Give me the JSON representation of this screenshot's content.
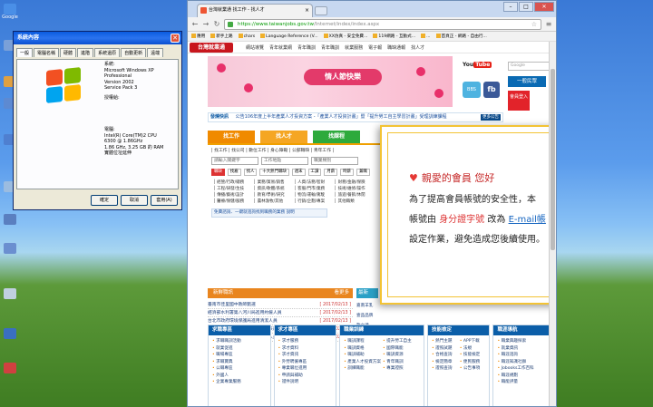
{
  "desktop": {
    "icons": [
      {
        "label": "Google",
        "color": "#4a8fe7"
      },
      {
        "label": "",
        "color": "#7aa0d8"
      },
      {
        "label": "",
        "color": "#e0a040"
      },
      {
        "label": "",
        "color": "#5d8ad2"
      },
      {
        "label": "",
        "color": "#4f7fd0"
      },
      {
        "label": "",
        "color": "#9bbce0"
      },
      {
        "label": "",
        "color": "#5a7fc0"
      },
      {
        "label": "",
        "color": "#6b8fd0"
      },
      {
        "label": "",
        "color": "#c0d0e0"
      },
      {
        "label": "",
        "color": "#3a6fc0"
      },
      {
        "label": "",
        "color": "#d04040"
      }
    ]
  },
  "system_properties": {
    "title": "系統內容",
    "tabs": [
      "一般",
      "電腦名稱",
      "硬體",
      "進階",
      "系統還原",
      "自動更新",
      "遠端"
    ],
    "system_label": "系統:",
    "os_name": "Microsoft Windows XP",
    "edition": "Professional",
    "version": "Version 2002",
    "service_pack": "Service Pack 3",
    "registered_label": "授權給:",
    "computer_label": "電腦:",
    "cpu1": "Intel(R) Core(TM)2 CPU",
    "cpu2": "6300 @ 1.86GHz",
    "memory": "1.86 GHz, 3.25 GB 的 RAM",
    "pae": "實體位址延伸",
    "ok_button": "確定",
    "cancel_button": "取消",
    "apply_button": "套用(A)"
  },
  "browser": {
    "tab_title": "台灣就業通 找工作 - 找人才",
    "url_host": "https://www.taiwanjobs.gov.tw",
    "url_path": "/Internet/index/index.aspx",
    "bookmarks": [
      "應用",
      "新手上路",
      "chars",
      "Language Reference (V...",
      "XX仿真 - 安全免費...",
      "119網路 - 互動式...",
      "...",
      "首頁正 - 網路 - 自由行..."
    ],
    "window_controls": [
      "–",
      "□",
      "✕"
    ]
  },
  "site": {
    "logo": "台灣就業通",
    "topnav": [
      "網站導覽",
      "青年就業網",
      "青年職訓",
      "青年職訓",
      "就業服務",
      "電子報",
      "職缺通報",
      "找人才"
    ],
    "hero_text": "情人節快樂",
    "youtube": "You",
    "youtube_tube": "Tube",
    "bbs": "BBS",
    "fb": "fb",
    "search_placeholder": "Google",
    "general_user": "一般民眾",
    "member_login": "會員登入",
    "news_label": "發燒快訊",
    "news_text": "公告106年度上半年產業人才投資方案 -「產業人才投資計畫」暨「提升勞工自主學習計畫」受理訓練課程",
    "news_more": "更多公告",
    "job_tabs": [
      {
        "label": "找工作",
        "color": "#f08a00"
      },
      {
        "label": "找人才",
        "color": "#f5a623"
      },
      {
        "label": "找課程",
        "color": "#2eaa3c"
      }
    ],
    "panel_links": "| 找工作 | 找公司 | 數位工作 | 身心障礙 | 公部職缺 | 青年工作 |",
    "keyword_placeholder": "請輸入關鍵字",
    "select_area": "工作地點",
    "select_category": "職業類別",
    "chips": [
      "職缺",
      "找雇",
      "找人",
      "十大熱門職缺",
      "週末",
      "工讀",
      "月薪",
      "時薪",
      "兼職"
    ],
    "categories": [
      "經營/行政/總務",
      "業務/貿易/銷售",
      "人資/法務/智財",
      "財務/金融/保險",
      "工程/研發/生技",
      "資訊/軟體/系統",
      "客服/門市/業務",
      "技術/維修/操作",
      "傳播/藝術/設計",
      "教育/學術/研究",
      "物流/運輸/駕駛",
      "旅遊/餐飲/休閒",
      "醫療/保健/服務",
      "農林漁牧/其他",
      "行銷/企劃/專案",
      "其他職類"
    ],
    "note_text": "免費諮詢、一鍵就諮詢找到職務的業務",
    "note_link": "說明",
    "latest_title": "新鮮職訊",
    "latest_more": "看更多",
    "latest": [
      {
        "title": "臺南市佳里國中教師甄選",
        "date": "[ 2017/02/13 ]"
      },
      {
        "title": "經濟部水利署第八河川局進用約僱人員",
        "date": "[ 2017/02/13 ]"
      },
      {
        "title": "台北市政府環境保護局進用清潔人員",
        "date": "[ 2017/02/13 ]"
      },
      {
        "title": "臺北市政府捷運工程局2/14-2/16進行甄試",
        "date": "[ 2017/02/13 ]"
      },
      {
        "title": "桃園市政府衛生局進用職務代理人員",
        "date": "[ 2017/02/13 ]"
      }
    ],
    "side_title": "最新",
    "side_items": [
      "嘉南羊乳",
      "壹品品牌",
      "歐立達",
      "多到府",
      "2/14-2/"
    ],
    "bottom_cols": [
      {
        "title": "求職專區",
        "items": [
          "求職職訓活動",
          "就業促進",
          "職場專區",
          "求職寶典",
          "公職專區",
          "外國人",
          "企業專業服務"
        ],
        "cls": "one"
      },
      {
        "title": "求才專區",
        "items": [
          "求才服務",
          "求才資料",
          "求才資訊",
          "外勞聘僱專區",
          "專業職位進用",
          "申請與補助",
          "證件說明"
        ],
        "cls": "one"
      },
      {
        "title": "職業訓練",
        "items": [
          "職訓課程",
          "職訓資格",
          "職訓補助",
          "產業人才投資方案",
          "訓練職能",
          "提升勞工自主",
          "國際職能",
          "職訓資源",
          "青年職訓",
          "專業證照"
        ],
        "cls": ""
      },
      {
        "title": "技能檢定",
        "items": [
          "熱門主題",
          "證照試題",
          "合格查詢",
          "檢定簡章",
          "證照查詢",
          "APP下載",
          "法規",
          "技能檢定",
          "便民服務",
          "公告事項"
        ],
        "cls": ""
      },
      {
        "title": "職涯導航",
        "items": [
          "職業興趣探索",
          "就業資訊",
          "職涯諮詢",
          "職涯知識社群",
          "Jobooks工作百科",
          "職涯規劃",
          "職能評量"
        ],
        "cls": "one"
      }
    ]
  },
  "popup": {
    "greeting": "親愛的會員 您好",
    "line1": "為了提高會員帳號的安全性，本",
    "line2_pre": "帳號由",
    "line2_hl": "身分證字號",
    "line2_mid": "改為",
    "line2_lk": "E-mail帳",
    "line3": "設定作業，避免造成您後續使用。"
  }
}
